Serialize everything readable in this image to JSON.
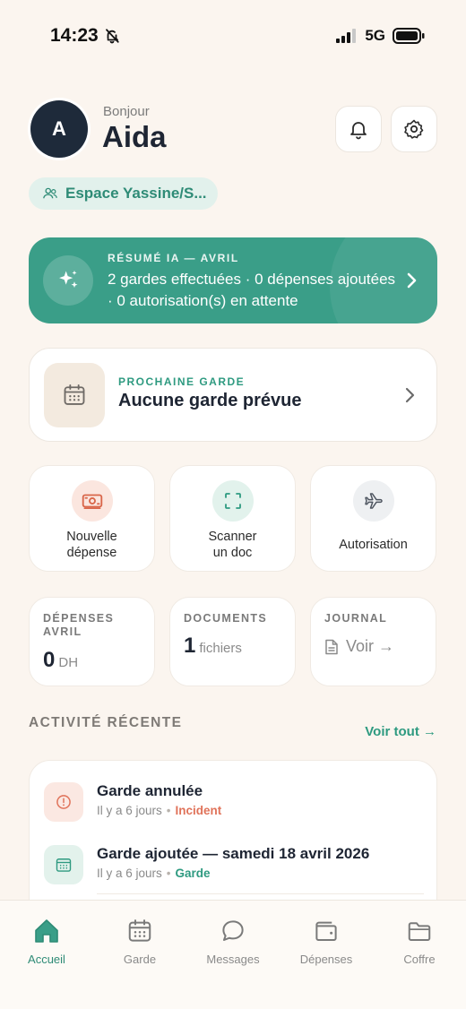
{
  "status_bar": {
    "time": "14:23",
    "network": "5G"
  },
  "header": {
    "avatar_initial": "A",
    "greeting": "Bonjour",
    "name": "Aida"
  },
  "space": {
    "label": "Espace Yassine/S..."
  },
  "ai_summary": {
    "label": "RÉSUMÉ IA — AVRIL",
    "text": "2 gardes effectuées · 0 dépenses ajoutées · 0 autorisation(s) en attente"
  },
  "next_custody": {
    "label": "PROCHAINE GARDE",
    "title": "Aucune garde prévue"
  },
  "actions": [
    {
      "line1": "Nouvelle",
      "line2": "dépense"
    },
    {
      "line1": "Scanner",
      "line2": "un doc"
    },
    {
      "line1": "Autorisation"
    }
  ],
  "stats": {
    "expenses": {
      "label_line1": "DÉPENSES",
      "label_line2": "AVRIL",
      "value": "0",
      "unit": "DH"
    },
    "documents": {
      "label": "DOCUMENTS",
      "value": "1",
      "unit": "fichiers"
    },
    "journal": {
      "label": "JOURNAL",
      "link": "Voir →"
    }
  },
  "recent_activity": {
    "title": "ACTIVITÉ RÉCENTE",
    "see_all": "Voir tout →",
    "items": [
      {
        "title": "Garde annulée",
        "time": "Il y a 6 jours",
        "tag": "Incident",
        "tag_color": "#E0735A"
      },
      {
        "title": "Garde ajoutée — samedi 18 avril 2026",
        "time": "Il y a 6 jours",
        "tag": "Garde",
        "tag_color": "#2E9A80"
      }
    ]
  },
  "tabs": [
    {
      "label": "Accueil",
      "active": true
    },
    {
      "label": "Garde"
    },
    {
      "label": "Messages"
    },
    {
      "label": "Dépenses"
    },
    {
      "label": "Coffre"
    }
  ],
  "colors": {
    "accent": "#3A9E88",
    "background": "#FBF5EF",
    "incident": "#E0735A"
  }
}
